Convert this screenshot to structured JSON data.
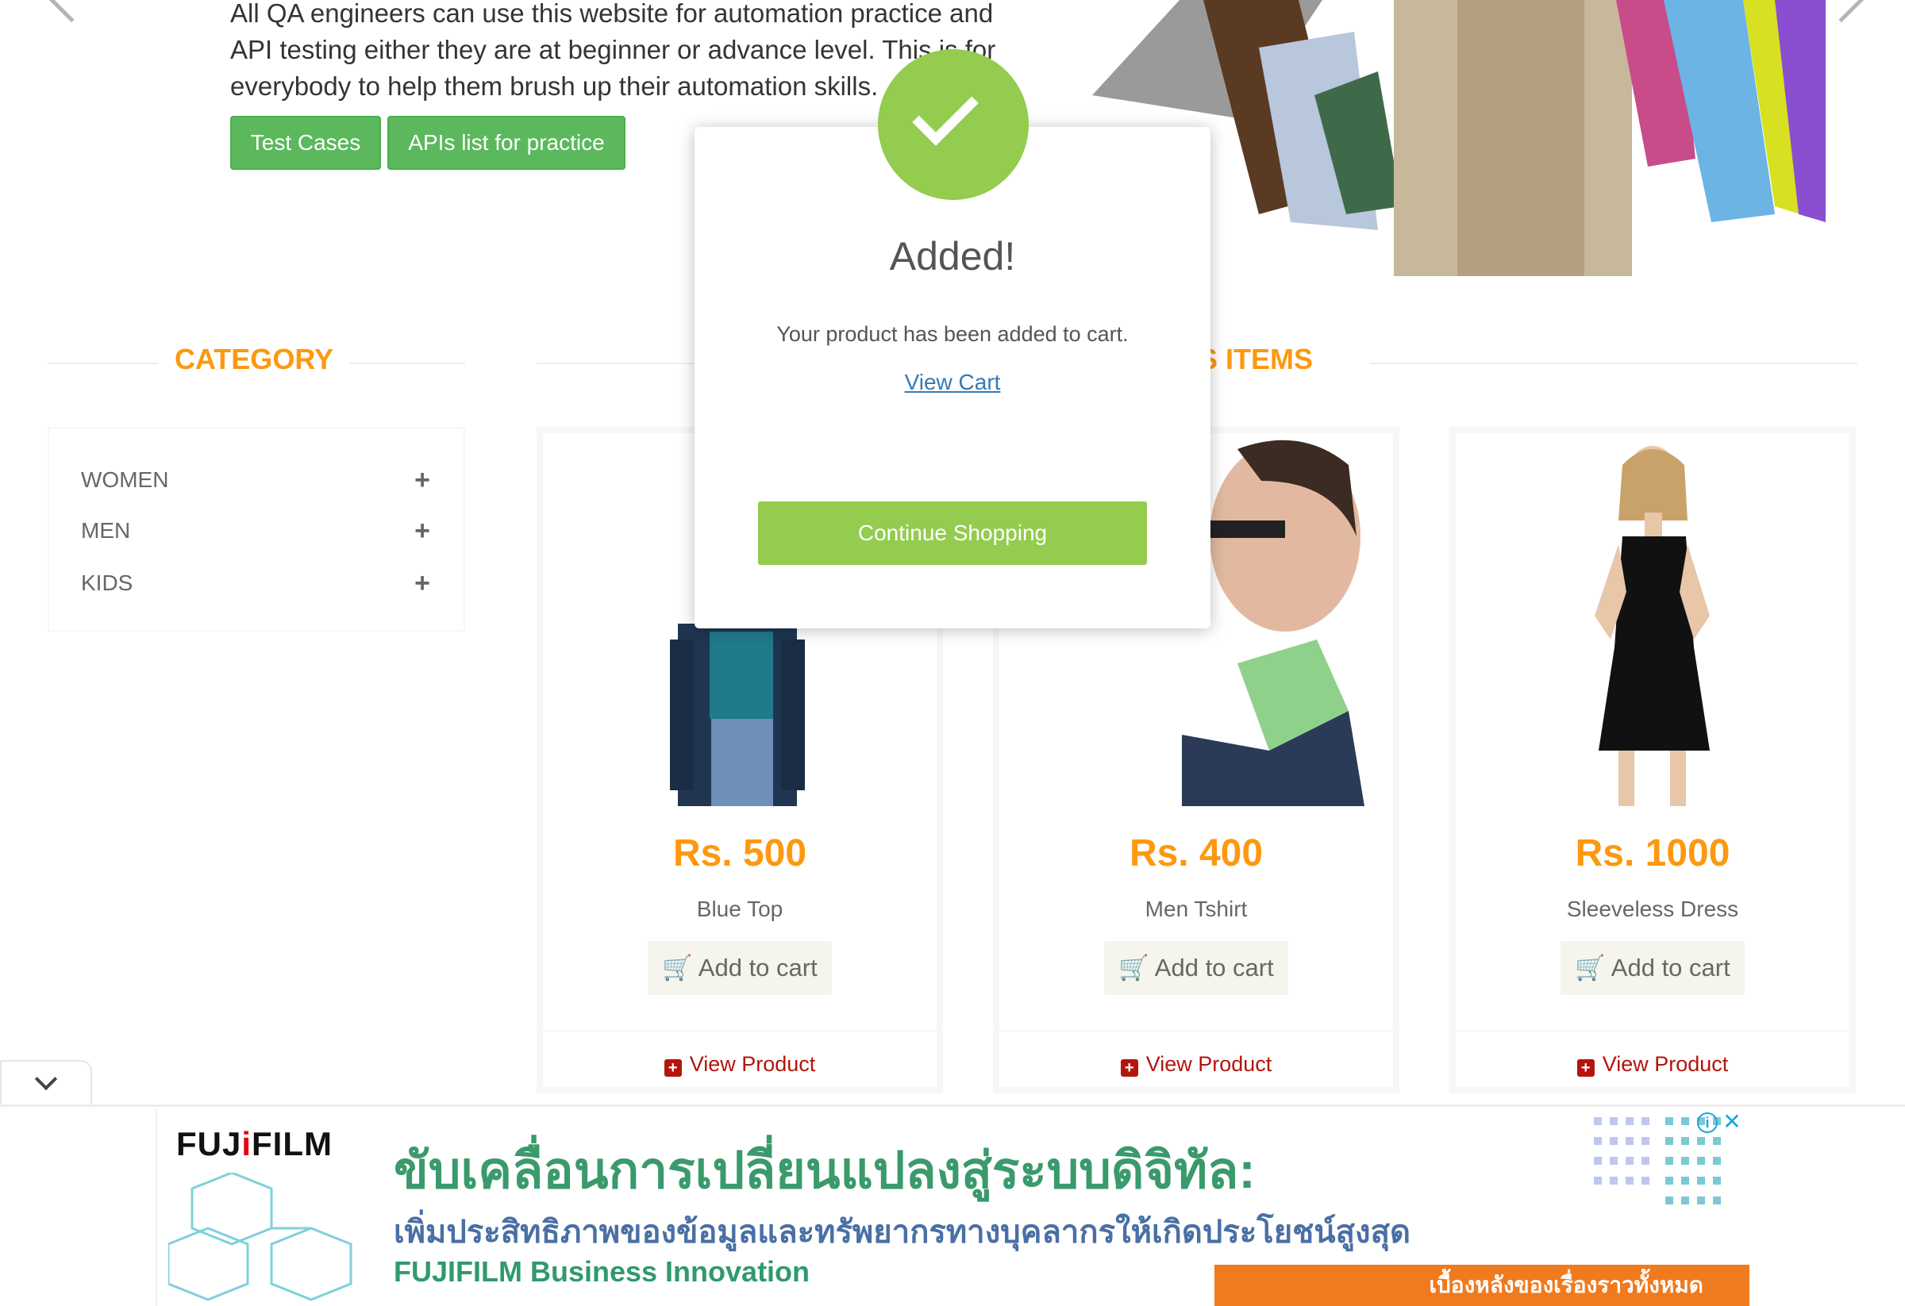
{
  "hero": {
    "text": "All QA engineers can use this website for automation practice and API testing either they are at beginner or advance level. This is for everybody to help them brush up their automation skills.",
    "test_cases_label": "Test Cases",
    "apis_label": "APIs list for practice"
  },
  "category": {
    "title": "CATEGORY",
    "items": [
      {
        "label": "WOMEN"
      },
      {
        "label": "MEN"
      },
      {
        "label": "KIDS"
      }
    ]
  },
  "features": {
    "title_visible": "S ITEMS"
  },
  "products": [
    {
      "price": "Rs. 500",
      "name": "Blue Top",
      "add_label": "Add to cart",
      "view_label": "View Product"
    },
    {
      "price": "Rs. 400",
      "name": "Men Tshirt",
      "add_label": "Add to cart",
      "view_label": "View Product"
    },
    {
      "price": "Rs. 1000",
      "name": "Sleeveless Dress",
      "add_label": "Add to cart",
      "view_label": "View Product"
    }
  ],
  "modal": {
    "title": "Added!",
    "message": "Your product has been added to cart.",
    "link": "View Cart",
    "continue_label": "Continue Shopping"
  },
  "ad": {
    "logo_left": "FUJ",
    "logo_dot": "i",
    "logo_right": "FILM",
    "headline": "ขับเคลื่อนการเปลี่ยนแปลงสู่ระบบดิจิทัล:",
    "subline": "เพิ่มประสิทธิภาพของข้อมูลและทรัพยากรทางบุคลากรให้เกิดประโยชน์สูงสุด",
    "brand": "FUJIFILM Business Innovation",
    "cta": "เบื้องหลังของเรื่องราวทั้งหมด"
  },
  "colors": {
    "accent_orange": "#fe980f",
    "success_green": "#93cc4f",
    "button_green": "#5cb85c",
    "view_product_red": "#b3150d"
  }
}
